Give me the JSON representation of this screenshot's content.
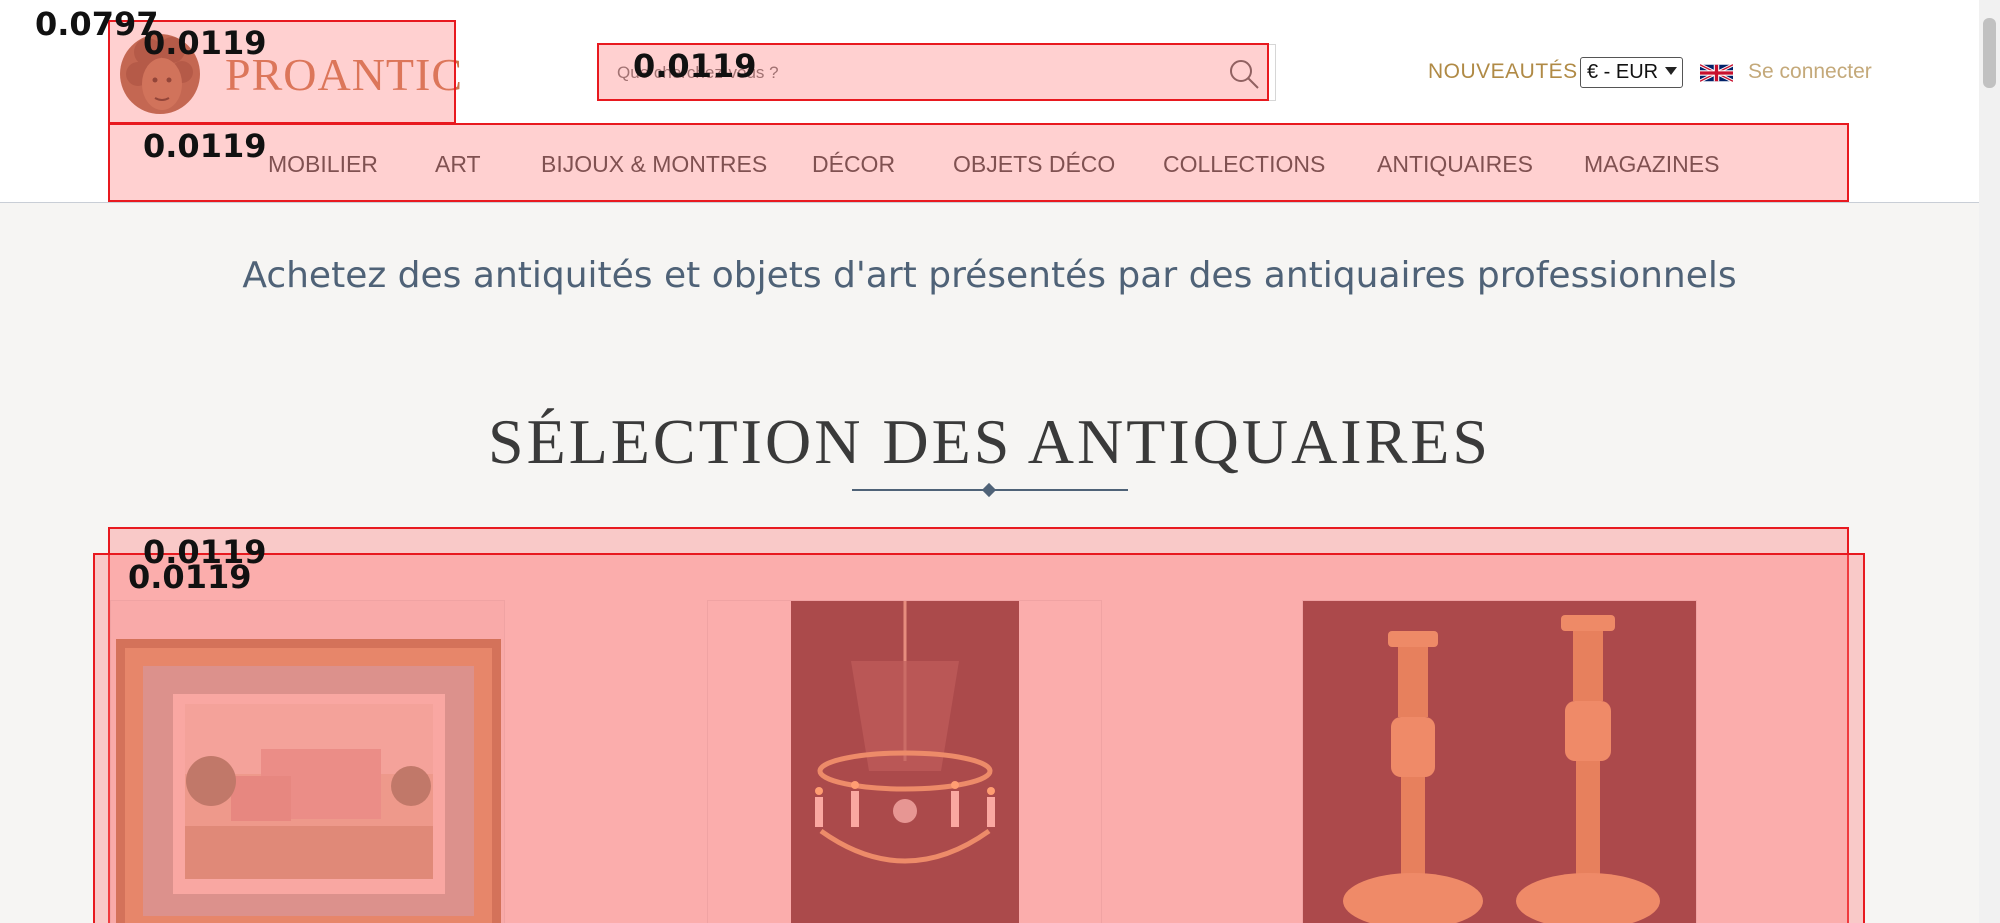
{
  "header": {
    "logo_text": "PROANTIC",
    "search": {
      "placeholder": "Que cherchez-vous ?"
    },
    "nouveautes": "NOUVEAUTÉS",
    "currency": "€ - EUR",
    "login": "Se connecter"
  },
  "nav": {
    "items": [
      "MOBILIER",
      "ART",
      "BIJOUX & MONTRES",
      "DÉCOR",
      "OBJETS DÉCO",
      "COLLECTIONS",
      "ANTIQUAIRES",
      "MAGAZINES"
    ]
  },
  "main": {
    "subtitle": "Achetez des antiquités et objets d'art présentés par des antiquaires professionnels",
    "section_title": "SÉLECTION DES ANTIQUAIRES"
  },
  "annotations": {
    "page_score": "0.0797",
    "logo_score": "0.0119",
    "search_score": "0.0119",
    "nav_score": "0.0119",
    "cards_score_a": "0.0119",
    "cards_score_b": "0.0119"
  },
  "colors": {
    "accent_gold": "#b08a45",
    "logo": "#c9754a",
    "title_blue": "#4f6277",
    "annotation_red": "#e8191f"
  }
}
